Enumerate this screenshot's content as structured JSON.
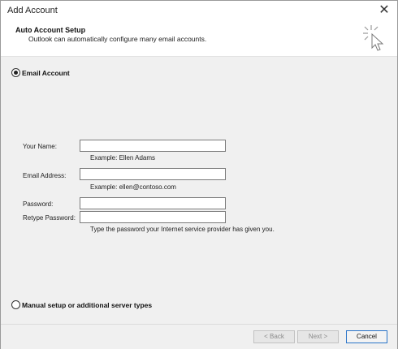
{
  "window": {
    "title": "Add Account",
    "close_glyph": "✕"
  },
  "header": {
    "title": "Auto Account Setup",
    "subtitle": "Outlook can automatically configure many email accounts.",
    "icon": "wizard-cursor-icon"
  },
  "options": {
    "email_account": {
      "label": "Email Account",
      "checked": true
    },
    "manual_setup": {
      "label": "Manual setup or additional server types",
      "checked": false
    }
  },
  "form": {
    "your_name": {
      "label": "Your Name:",
      "value": "",
      "hint": "Example: Ellen Adams"
    },
    "email_address": {
      "label": "Email Address:",
      "value": "",
      "hint": "Example: ellen@contoso.com"
    },
    "password": {
      "label": "Password:",
      "value": ""
    },
    "retype_password": {
      "label": "Retype Password:",
      "value": ""
    },
    "password_hint": "Type the password your Internet service provider has given you."
  },
  "buttons": {
    "back": "< Back",
    "next": "Next >",
    "cancel": "Cancel"
  },
  "colors": {
    "accent": "#2a74c9",
    "background": "#f0f0f0"
  }
}
